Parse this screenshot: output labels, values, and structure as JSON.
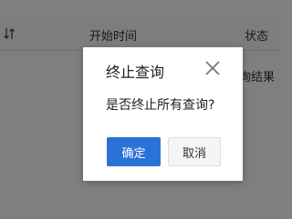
{
  "table": {
    "columns": {
      "start_time": "开始时间",
      "status": "状态"
    },
    "row_partial_text": "询结果"
  },
  "dialog": {
    "title": "终止查询",
    "message": "是否终止所有查询?",
    "ok_label": "确定",
    "cancel_label": "取消"
  },
  "colors": {
    "primary": "#2b72d6",
    "overlay": "rgba(0,0,0,0.5)"
  },
  "icons": {
    "sort": "sort-icon",
    "close": "close-icon"
  }
}
